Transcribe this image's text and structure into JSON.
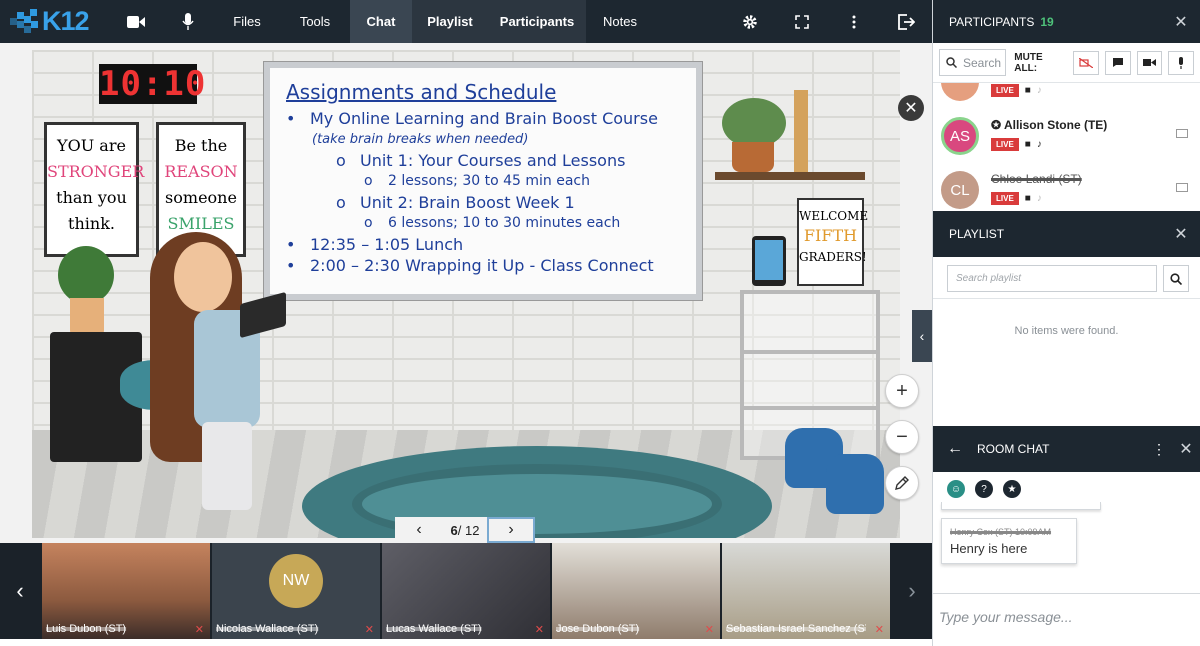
{
  "topbar": {
    "logo": "K12",
    "icons": [
      "video-camera-icon",
      "microphone-icon"
    ],
    "menu": [
      "Files",
      "Tools",
      "Chat",
      "Playlist",
      "Participants",
      "Notes"
    ],
    "right_icons": [
      "gear-icon",
      "fullscreen-icon",
      "more-vertical-icon",
      "exit-icon"
    ]
  },
  "slide": {
    "clock": "10:10",
    "poster_left": [
      "YOU are",
      "STRONGER",
      "than you",
      "think."
    ],
    "poster_mid": [
      "Be the",
      "REASON",
      "someone",
      "SMILES"
    ],
    "poster_right": [
      "WELCOME",
      "FIFTH",
      "GRADERS!"
    ],
    "board_title": "Assignments and Schedule",
    "board_lines": [
      {
        "level": 1,
        "bullet": "•",
        "text": "My Online Learning and Brain Boost Course"
      },
      {
        "level": 2,
        "bullet": "",
        "text": "(take brain breaks when needed)"
      },
      {
        "level": 3,
        "bullet": "o",
        "text": "Unit 1: Your Courses and Lessons"
      },
      {
        "level": 4,
        "bullet": "o",
        "text": "2 lessons; 30 to 45 min each"
      },
      {
        "level": 3,
        "bullet": "o",
        "text": "Unit 2: Brain Boost Week 1"
      },
      {
        "level": 4,
        "bullet": "o",
        "text": "6 lessons; 10 to 30 minutes each"
      },
      {
        "level": 1,
        "bullet": "•",
        "text": "12:35 – 1:05 Lunch"
      },
      {
        "level": 1,
        "bullet": "•",
        "text": "2:00 – 2:30 Wrapping it Up - Class Connect"
      }
    ]
  },
  "controls": {
    "zoom_in": "+",
    "zoom_out": "−",
    "close": "✕",
    "collapse": "‹"
  },
  "pager": {
    "current": "6",
    "total": "/ 12",
    "prev": "‹",
    "next": "›"
  },
  "video_strip": {
    "tiles": [
      {
        "label": "Luis Dubon (ST)",
        "avatar": ""
      },
      {
        "label": "Nicolas Wallace (ST)",
        "avatar": "NW"
      },
      {
        "label": "Lucas Wallace (ST)",
        "avatar": ""
      },
      {
        "label": "Jose Dubon (ST)",
        "avatar": ""
      },
      {
        "label": "Sebastian Israel Sanchez (ST)",
        "avatar": ""
      }
    ]
  },
  "participants": {
    "title": "PARTICIPANTS",
    "count": "19",
    "search_placeholder": "Search",
    "mute_all": "MUTE ALL:",
    "live": "LIVE",
    "rows": [
      {
        "initials": "",
        "name": "",
        "teacher": false,
        "strike": false
      },
      {
        "initials": "AS",
        "name": "Allison Stone (TE)",
        "teacher": true,
        "strike": false
      },
      {
        "initials": "CL",
        "name": "Chloe Landi (ST)",
        "teacher": false,
        "strike": true
      }
    ]
  },
  "playlist": {
    "title": "PLAYLIST",
    "search_placeholder": "Search playlist",
    "empty": "No items were found."
  },
  "chat": {
    "title": "ROOM CHAT",
    "message_author": "Henry Cox (ST) 10:09AM",
    "message_text": "Henry is here",
    "input_placeholder": "Type your message..."
  },
  "colors": {
    "topbar": "#1d2730",
    "accent_blue": "#39a2ea",
    "live_red": "#d93b3b",
    "count_green": "#4ec27a",
    "board_text": "#1f3f9a"
  }
}
